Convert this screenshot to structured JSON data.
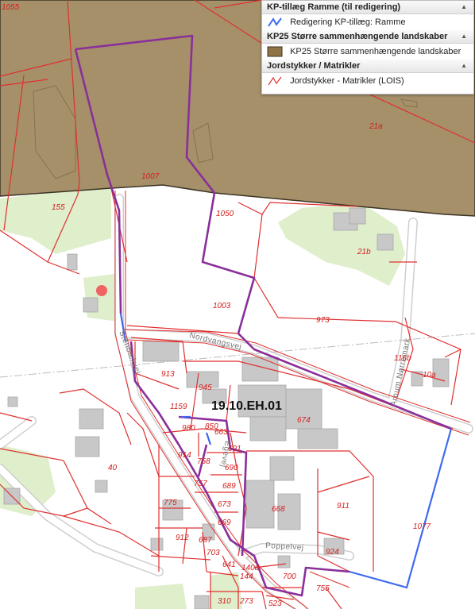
{
  "legend": {
    "groups": [
      {
        "title": "KP-tillæg Ramme (til redigering)",
        "arrow": "▲",
        "items": [
          {
            "label": "Redigering KP-tillæg: Ramme",
            "symbol": "blue-line-icon",
            "color": "#3d6bf0"
          }
        ]
      },
      {
        "title": "KP25 Større sammenhængende landskaber",
        "arrow": "▲",
        "items": [
          {
            "label": "KP25 Større sammenhængende landskaber",
            "symbol": "brown-fill-icon",
            "color": "#8f7444"
          }
        ]
      },
      {
        "title": "Jordstykker / Matrikler",
        "arrow": "▲",
        "items": [
          {
            "label": "Jordstykker - Matrikler (LOIS)",
            "symbol": "red-line-icon",
            "color": "#e03030"
          }
        ]
      }
    ]
  },
  "map": {
    "colors": {
      "landscape_fill": "#8f7444",
      "parcel_line": "#e03030",
      "frame_line": "#8a2f9a",
      "edit_line": "#3d6bf0",
      "green_area": "#dfeecb",
      "building": "#c8c8c8",
      "road": "#ffffff",
      "marker": "#f06464"
    },
    "plan_label": "19.10.EH.01",
    "road_names": {
      "nordvangsvej": "Nordvangsvej",
      "stenbaekvej": "Stenbækvej",
      "arnum_norremark": "Arnum Nørremark",
      "poppelvej": "Poppelvej",
      "egevej": "Egevej"
    },
    "parcels": {
      "p1055": "1055",
      "p21a": "21a",
      "p1007": "1007",
      "p155": "155",
      "p1050": "1050",
      "p21b": "21b",
      "p1003": "1003",
      "p973": "973",
      "p116b": "116b",
      "p10a": "10a",
      "p913": "913",
      "p945": "945",
      "p1159": "1159",
      "p674": "674",
      "p980": "980",
      "p850": "850",
      "p691": "691",
      "p914": "914",
      "p758": "758",
      "p690": "690",
      "p757": "757",
      "p689": "689",
      "p40": "40",
      "p775": "775",
      "p673": "673",
      "p668": "668",
      "p911": "911",
      "p1077": "1077",
      "p669": "669",
      "p912": "912",
      "p687": "687",
      "p924": "924",
      "p703": "703",
      "p641": "641",
      "p700": "700",
      "p140d": "140d",
      "p144": "144",
      "p755": "755",
      "p310": "310",
      "p273": "273",
      "p523": "523",
      "p663": "663"
    }
  }
}
